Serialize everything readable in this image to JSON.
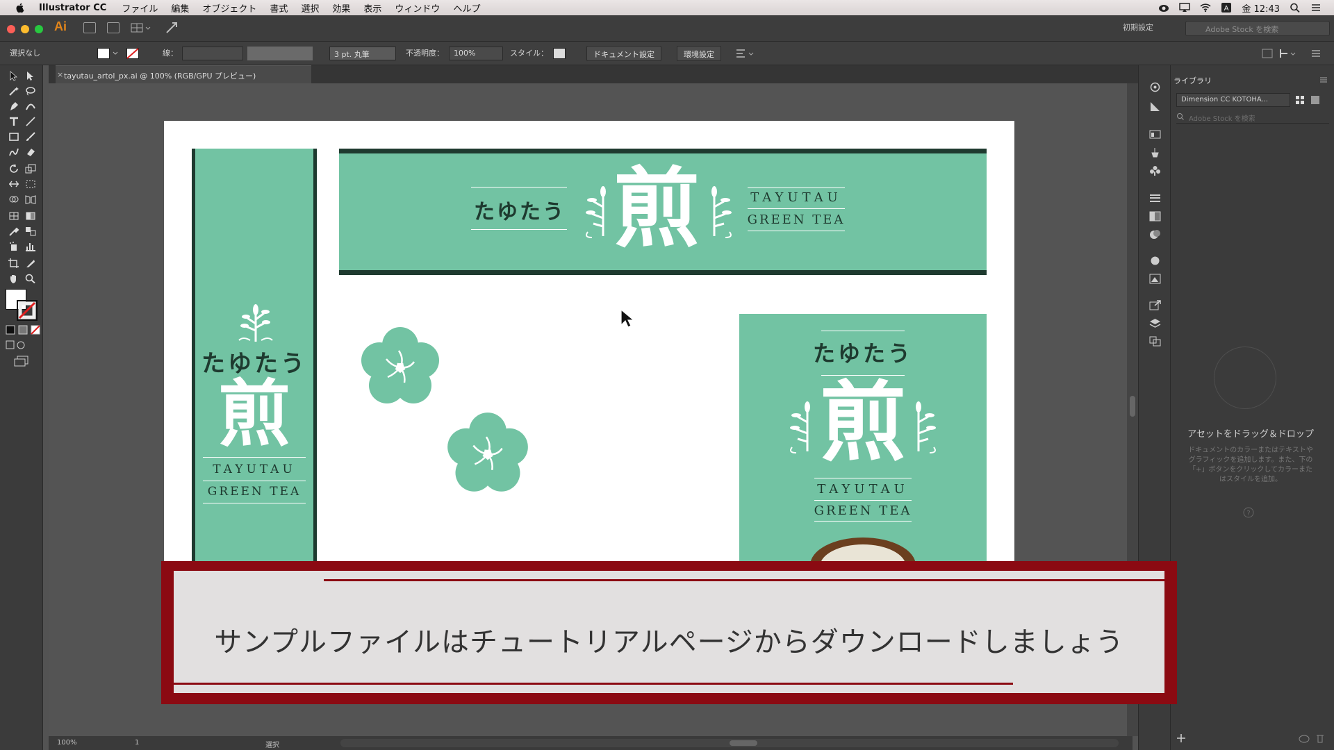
{
  "menubar": {
    "app_name": "Illustrator CC",
    "items": [
      "ファイル",
      "編集",
      "オブジェクト",
      "書式",
      "選択",
      "効果",
      "表示",
      "ウィンドウ",
      "ヘルプ"
    ],
    "clock": "金 12:43"
  },
  "appbar": {
    "logo": "Ai",
    "workspace": "初期設定",
    "stock_search_placeholder": "Adobe Stock を検索"
  },
  "controlbar": {
    "selection": "選択なし",
    "stroke_label": "線：",
    "brush": "3 pt. 丸筆",
    "opacity_label": "不透明度：",
    "opacity_value": "100%",
    "style_label": "スタイル：",
    "doc_setup_button": "ドキュメント設定",
    "prefs_button": "環境設定"
  },
  "document": {
    "tab_title": "tayutau_artol_px.ai @ 100% (RGB/GPU プレビュー)",
    "close": "×"
  },
  "artwork": {
    "brand_jp": "たゆたう",
    "kanji": "煎",
    "brand_en_1": "TAYUTAU",
    "brand_en_2": "GREEN TEA",
    "colors": {
      "green": "#72c3a3",
      "dark": "#1e3a2f",
      "white": "#ffffff"
    }
  },
  "library": {
    "title": "ライブラリ",
    "dropdown": "Dimension CC KOTOHA...",
    "search_placeholder": "Adobe Stock を検索",
    "drop_title": "アセットをドラッグ＆ドロップ",
    "drop_body": "ドキュメントのカラーまたはテキストやグラフィックを追加します。また、下の「+」ボタンをクリックしてカラーまたはスタイルを追加。"
  },
  "statusbar": {
    "zoom": "100%",
    "artboard": "1",
    "tool": "選択"
  },
  "caption": {
    "text": "サンプルファイルはチュートリアルページからダウンロードしましょう",
    "color": "#8b0a12"
  }
}
